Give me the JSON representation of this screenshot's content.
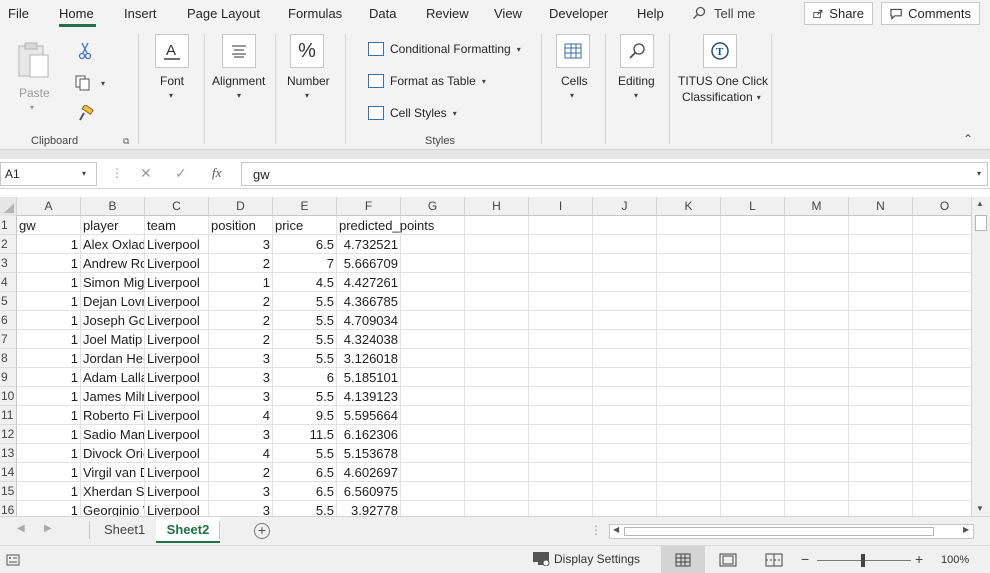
{
  "menu": {
    "items": [
      "File",
      "Home",
      "Insert",
      "Page Layout",
      "Formulas",
      "Data",
      "Review",
      "View",
      "Developer",
      "Help"
    ],
    "tellme": "Tell me",
    "share": "Share",
    "comments": "Comments"
  },
  "ribbon": {
    "paste": "Paste",
    "clipboard": "Clipboard",
    "font": "Font",
    "alignment": "Alignment",
    "number": "Number",
    "conditional_formatting": "Conditional Formatting",
    "format_as_table": "Format as Table",
    "cell_styles": "Cell Styles",
    "styles": "Styles",
    "cells": "Cells",
    "editing": "Editing",
    "titus_line1": "TITUS One Click",
    "titus_line2": "Classification"
  },
  "formula_bar": {
    "name_box": "A1",
    "content": "gw"
  },
  "columns": [
    "A",
    "B",
    "C",
    "D",
    "E",
    "F",
    "G",
    "H",
    "I",
    "J",
    "K",
    "L",
    "M",
    "N",
    "O"
  ],
  "header_row": [
    "gw",
    "player",
    "team",
    "position",
    "price",
    "predicted_points"
  ],
  "rows": [
    {
      "n": "2",
      "gw": "1",
      "player": "Alex Oxlade-Chamberlain",
      "team": "Liverpool",
      "position": "3",
      "price": "6.5",
      "pred": "4.732521"
    },
    {
      "n": "3",
      "gw": "1",
      "player": "Andrew Robertson",
      "team": "Liverpool",
      "position": "2",
      "price": "7",
      "pred": "5.666709"
    },
    {
      "n": "4",
      "gw": "1",
      "player": "Simon Mignolet",
      "team": "Liverpool",
      "position": "1",
      "price": "4.5",
      "pred": "4.427261"
    },
    {
      "n": "5",
      "gw": "1",
      "player": "Dejan Lovren",
      "team": "Liverpool",
      "position": "2",
      "price": "5.5",
      "pred": "4.366785"
    },
    {
      "n": "6",
      "gw": "1",
      "player": "Joseph Gomez",
      "team": "Liverpool",
      "position": "2",
      "price": "5.5",
      "pred": "4.709034"
    },
    {
      "n": "7",
      "gw": "1",
      "player": "Joel Matip",
      "team": "Liverpool",
      "position": "2",
      "price": "5.5",
      "pred": "4.324038"
    },
    {
      "n": "8",
      "gw": "1",
      "player": "Jordan Henderson",
      "team": "Liverpool",
      "position": "3",
      "price": "5.5",
      "pred": "3.126018"
    },
    {
      "n": "9",
      "gw": "1",
      "player": "Adam Lallana",
      "team": "Liverpool",
      "position": "3",
      "price": "6",
      "pred": "5.185101"
    },
    {
      "n": "10",
      "gw": "1",
      "player": "James Milner",
      "team": "Liverpool",
      "position": "3",
      "price": "5.5",
      "pred": "4.139123"
    },
    {
      "n": "11",
      "gw": "1",
      "player": "Roberto Firmino",
      "team": "Liverpool",
      "position": "4",
      "price": "9.5",
      "pred": "5.595664"
    },
    {
      "n": "12",
      "gw": "1",
      "player": "Sadio Mané",
      "team": "Liverpool",
      "position": "3",
      "price": "11.5",
      "pred": "6.162306"
    },
    {
      "n": "13",
      "gw": "1",
      "player": "Divock Origi",
      "team": "Liverpool",
      "position": "4",
      "price": "5.5",
      "pred": "5.153678"
    },
    {
      "n": "14",
      "gw": "1",
      "player": "Virgil van Dijk",
      "team": "Liverpool",
      "position": "2",
      "price": "6.5",
      "pred": "4.602697"
    },
    {
      "n": "15",
      "gw": "1",
      "player": "Xherdan Shaqiri",
      "team": "Liverpool",
      "position": "3",
      "price": "6.5",
      "pred": "6.560975"
    },
    {
      "n": "16",
      "gw": "1",
      "player": "Georginio Wijnaldum",
      "team": "Liverpool",
      "position": "3",
      "price": "5.5",
      "pred": "3.92778"
    }
  ],
  "sheets": {
    "tab1": "Sheet1",
    "tab2": "Sheet2"
  },
  "status": {
    "display_settings": "Display Settings",
    "zoom": "100%"
  },
  "colors": {
    "accent": "#217346",
    "ribbon_bg": "#f3f3f3"
  }
}
